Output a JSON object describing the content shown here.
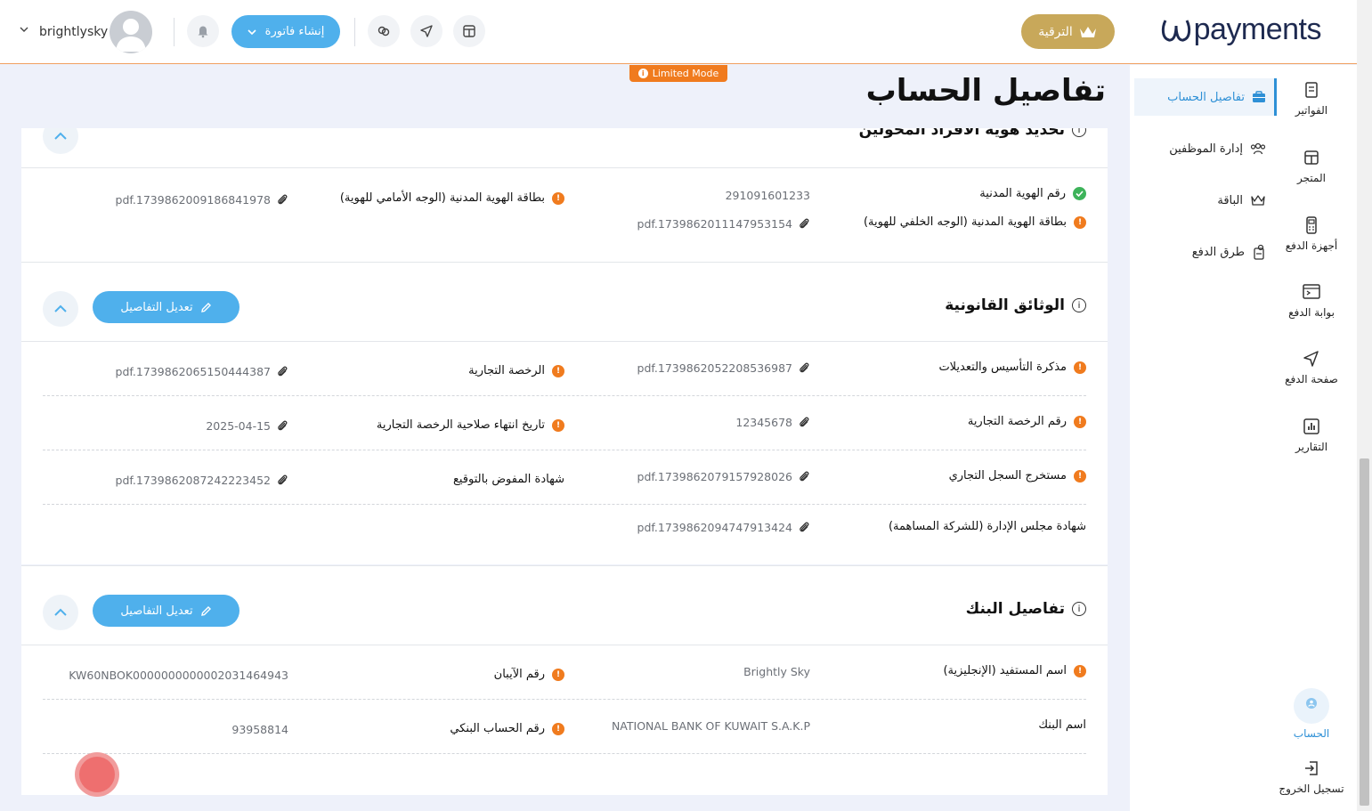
{
  "header": {
    "logo_text": "payments",
    "upgrade_label": "الترقية",
    "create_invoice_label": "إنشاء فاتورة",
    "username": "brightlysky"
  },
  "limited_mode": "Limited Mode",
  "page_title": "تفاصيل الحساب",
  "icon_nav": [
    {
      "label": "الفواتير",
      "icon": "invoice-icon"
    },
    {
      "label": "المتجر",
      "icon": "store-icon"
    },
    {
      "label": "أجهزة الدفع",
      "icon": "pos-device-icon"
    },
    {
      "label": "بوابة الدفع",
      "icon": "gateway-icon"
    },
    {
      "label": "صفحة الدفع",
      "icon": "send-icon"
    },
    {
      "label": "التقارير",
      "icon": "reports-icon"
    }
  ],
  "icon_nav_bottom": {
    "account_label": "الحساب",
    "logout_label": "تسجيل الخروج"
  },
  "submenu": [
    {
      "label": "تفاصيل الحساب",
      "icon": "briefcase-icon",
      "active": true
    },
    {
      "label": "إدارة الموظفين",
      "icon": "users-icon",
      "active": false
    },
    {
      "label": "الباقة",
      "icon": "crown-icon",
      "active": false
    },
    {
      "label": "طرق الدفع",
      "icon": "payment-methods-icon",
      "active": false
    }
  ],
  "sections": {
    "identity": {
      "title": "تحديد هوية الأفراد المخولين",
      "rows": [
        {
          "label": "رقم الهوية المدنية",
          "value": "291091601233",
          "status": "ok"
        },
        {
          "label": "بطاقة الهوية المدنية (الوجه الأمامي للهوية)",
          "value": "pdf.1739862009186841978",
          "status": "warn"
        },
        {
          "label": "بطاقة الهوية المدنية (الوجه الخلفي للهوية)",
          "value": "pdf.1739862011147953154",
          "status": "warn"
        }
      ]
    },
    "legal": {
      "title": "الوثائق القانونية",
      "edit_label": "تعديل التفاصيل",
      "rows": [
        {
          "label": "مذكرة التأسيس والتعديلات",
          "value": "pdf.1739862052208536987"
        },
        {
          "label": "الرخصة التجارية",
          "value": "pdf.1739862065150444387"
        },
        {
          "label": "رقم الرخصة التجارية",
          "value": "12345678"
        },
        {
          "label": "تاريخ انتهاء صلاحية الرخصة التجارية",
          "value": "2025-04-15"
        },
        {
          "label": "مستخرج السجل التجاري",
          "value": "pdf.1739862079157928026"
        },
        {
          "label": "شهادة المفوض بالتوقيع",
          "value": "pdf.1739862087242223452"
        },
        {
          "label": "شهادة مجلس الإدارة (للشركة المساهمة)",
          "value": "pdf.1739862094747913424"
        }
      ]
    },
    "bank": {
      "title": "تفاصيل البنك",
      "edit_label": "تعديل التفاصيل",
      "rows": [
        {
          "label": "اسم المستفيد (الإنجليزية)",
          "value": "Brightly Sky"
        },
        {
          "label": "رقم الآيبان",
          "value": "KW60NBOK0000000000002031464943"
        },
        {
          "label": "اسم البنك",
          "value": "NATIONAL BANK OF KUWAIT S.A.K.P"
        },
        {
          "label": "رقم الحساب البنكي",
          "value": "93958814"
        }
      ]
    }
  },
  "colors": {
    "accent": "#4fb0ec",
    "gold": "#c8a85a",
    "warning": "#f07b1e",
    "success": "#3db35a"
  }
}
